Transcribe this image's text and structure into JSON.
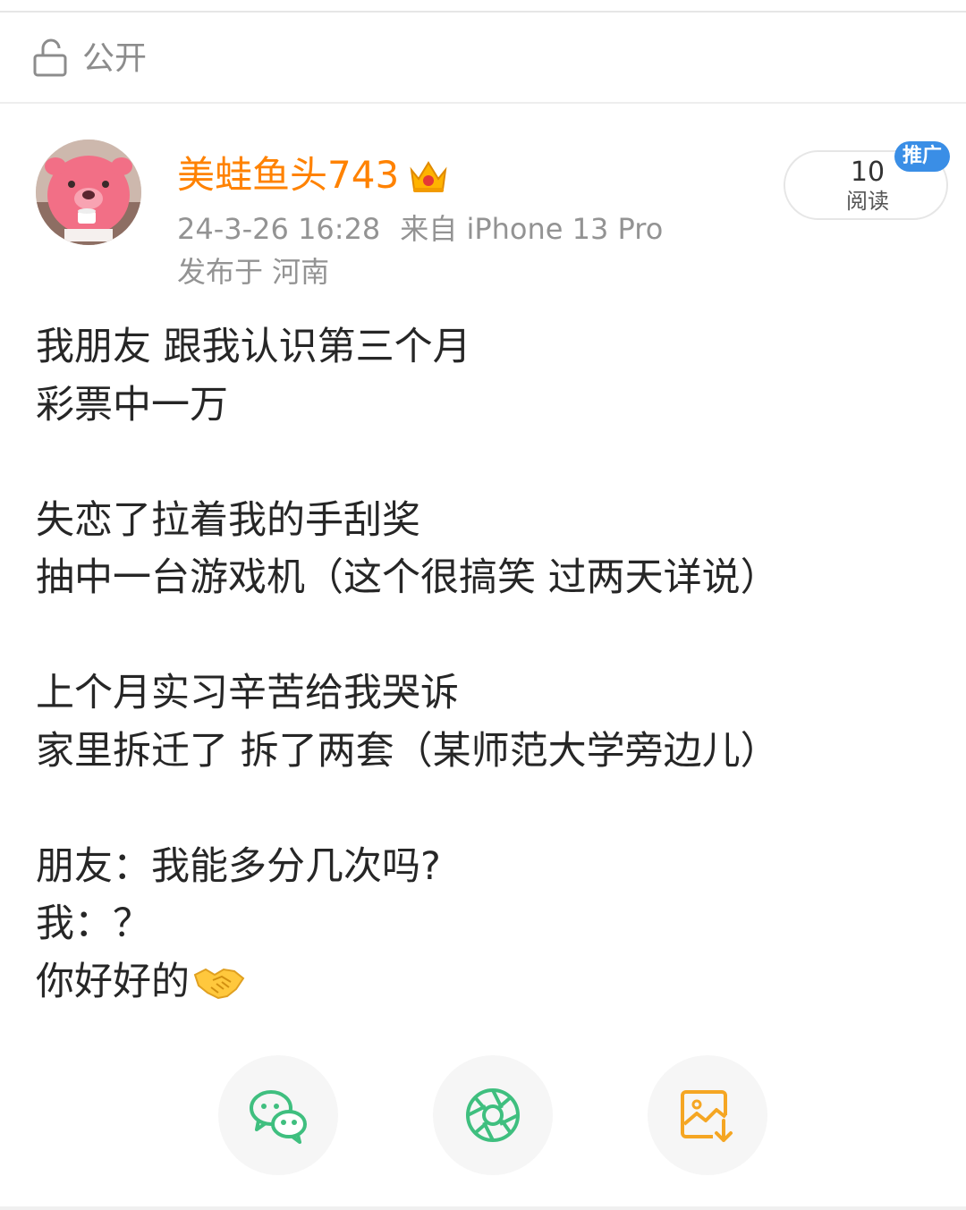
{
  "visibility": {
    "label": "公开",
    "icon": "unlock-icon"
  },
  "author": {
    "name": "美蛙鱼头743",
    "badge_icon": "crown-icon",
    "avatar_icon": "pink-beaver-avatar",
    "name_color": "#ff8200"
  },
  "meta": {
    "datetime": "24-3-26 16:28",
    "source": "来自 iPhone 13 Pro",
    "location": "发布于 河南"
  },
  "read_badge": {
    "count": "10",
    "unit": "阅读",
    "tag": "推广",
    "tag_color": "#3a8ee6"
  },
  "post": {
    "lines": [
      "我朋友 跟我认识第三个月",
      "彩票中一万",
      "",
      "失恋了拉着我的手刮奖",
      "抽中一台游戏机（这个很搞笑 过两天详说）",
      "",
      "上个月实习辛苦给我哭诉",
      "家里拆迁了 拆了两套（某师范大学旁边儿）",
      "",
      "朋友：我能多分几次吗?",
      "我：？",
      "你好好的"
    ],
    "last_emoji": "handshake-emoji"
  },
  "share": {
    "buttons": [
      {
        "icon": "wechat-icon",
        "color": "#3fbf7f"
      },
      {
        "icon": "moments-icon",
        "color": "#3fbf7f"
      },
      {
        "icon": "save-image-icon",
        "color": "#f5a623"
      }
    ]
  }
}
